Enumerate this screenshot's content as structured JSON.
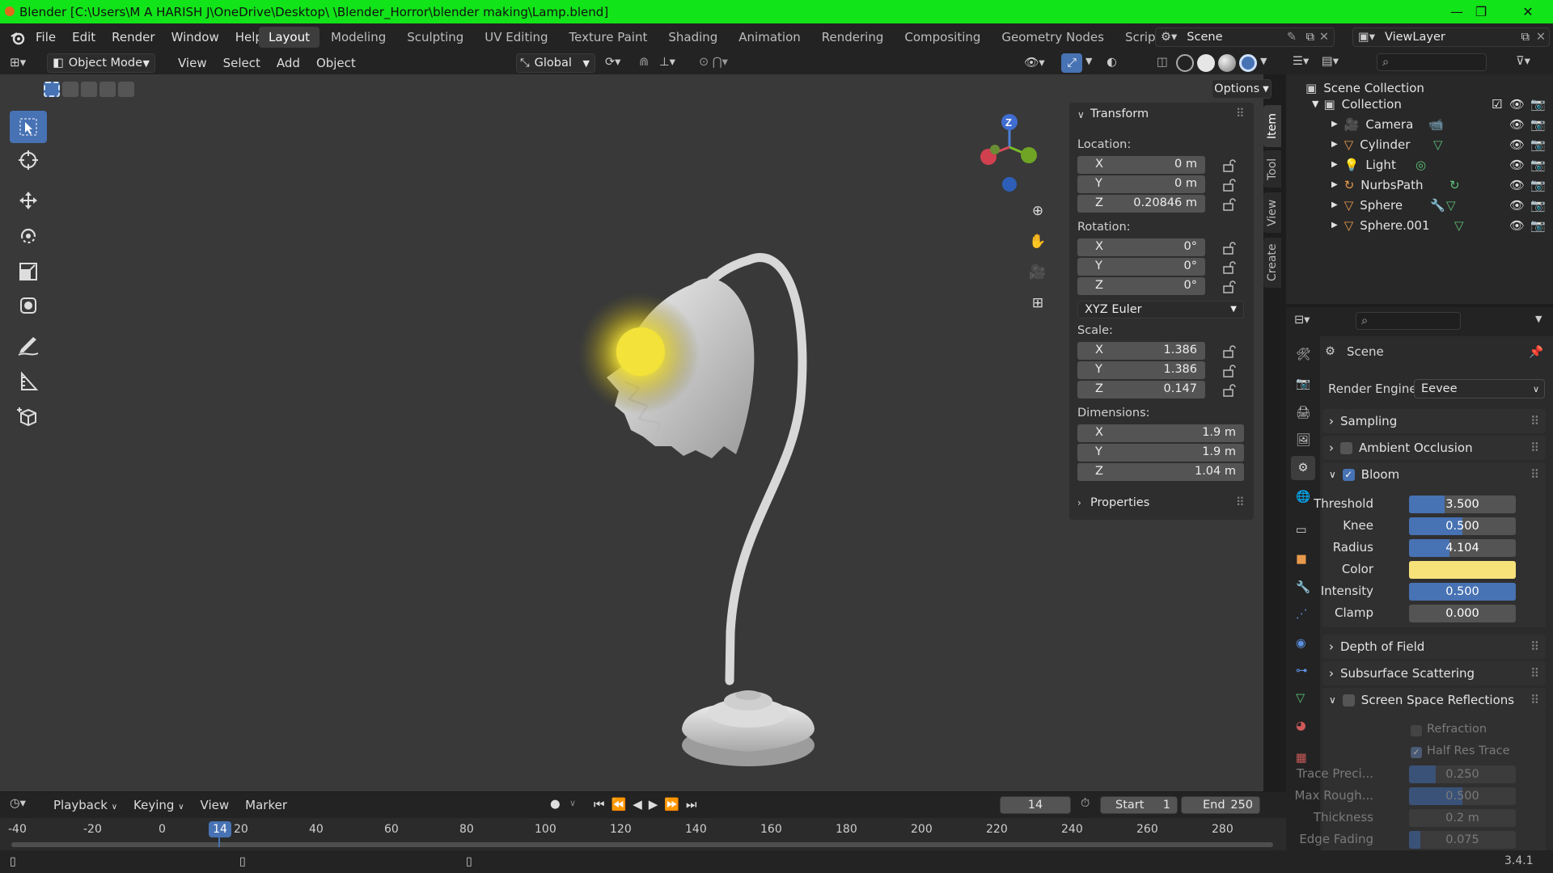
{
  "window": {
    "title": "Blender [C:\\Users\\M A HARISH J\\OneDrive\\Desktop\\ \\Blender_Horror\\blender making\\Lamp.blend]",
    "minimize": "—",
    "maximize": "❐",
    "close": "✕"
  },
  "menu": [
    "File",
    "Edit",
    "Render",
    "Window",
    "Help"
  ],
  "workspaces": [
    "Layout",
    "Modeling",
    "Sculpting",
    "UV Editing",
    "Texture Paint",
    "Shading",
    "Animation",
    "Rendering",
    "Compositing",
    "Geometry Nodes",
    "Scripting"
  ],
  "add_workspace": "+",
  "scene_name": "Scene",
  "viewlayer_name": "ViewLayer",
  "header": {
    "mode": "Object Mode",
    "menus": [
      "View",
      "Select",
      "Add",
      "Object"
    ],
    "orientation": "Global",
    "options": "Options"
  },
  "gizmo": {
    "z": "Z"
  },
  "npanel": {
    "transform_title": "Transform",
    "location_label": "Location:",
    "location": [
      {
        "axis": "X",
        "value": "0 m"
      },
      {
        "axis": "Y",
        "value": "0 m"
      },
      {
        "axis": "Z",
        "value": "0.20846 m"
      }
    ],
    "rotation_label": "Rotation:",
    "rotation": [
      {
        "axis": "X",
        "value": "0°"
      },
      {
        "axis": "Y",
        "value": "0°"
      },
      {
        "axis": "Z",
        "value": "0°"
      }
    ],
    "rotation_mode": "XYZ Euler",
    "scale_label": "Scale:",
    "scale": [
      {
        "axis": "X",
        "value": "1.386"
      },
      {
        "axis": "Y",
        "value": "1.386"
      },
      {
        "axis": "Z",
        "value": "0.147"
      }
    ],
    "dimensions_label": "Dimensions:",
    "dimensions": [
      {
        "axis": "X",
        "value": "1.9 m"
      },
      {
        "axis": "Y",
        "value": "1.9 m"
      },
      {
        "axis": "Z",
        "value": "1.04 m"
      }
    ],
    "properties_title": "Properties",
    "tabs": [
      "Item",
      "Tool",
      "View",
      "Create"
    ]
  },
  "outliner": {
    "root": "Scene Collection",
    "collection": "Collection",
    "items": [
      "Camera",
      "Cylinder",
      "Light",
      "NurbsPath",
      "Sphere",
      "Sphere.001"
    ]
  },
  "properties": {
    "context": "Scene",
    "render_engine_label": "Render Engine",
    "render_engine": "Eevee",
    "sampling": "Sampling",
    "ambient_occlusion": "Ambient Occlusion",
    "bloom": "Bloom",
    "bloom_fields": {
      "threshold_label": "Threshold",
      "threshold": "3.500",
      "knee_label": "Knee",
      "knee": "0.500",
      "radius_label": "Radius",
      "radius": "4.104",
      "color_label": "Color",
      "intensity_label": "Intensity",
      "intensity": "0.500",
      "clamp_label": "Clamp",
      "clamp": "0.000"
    },
    "bloom_color": "#f7e27a",
    "depth_of_field": "Depth of Field",
    "subsurface_scattering": "Subsurface Scattering",
    "screen_space_reflections": "Screen Space Reflections",
    "ssr": {
      "refraction": "Refraction",
      "half_res_trace": "Half Res Trace",
      "trace_precision_label": "Trace Preci...",
      "trace_precision": "0.250",
      "max_roughness_label": "Max Rough...",
      "max_roughness": "0.500",
      "thickness_label": "Thickness",
      "thickness": "0.2 m",
      "edge_fading_label": "Edge Fading",
      "edge_fading": "0.075"
    }
  },
  "timeline": {
    "menus": [
      "Playback",
      "Keying",
      "View",
      "Marker"
    ],
    "current_frame": "14",
    "start_label": "Start",
    "start": "1",
    "end_label": "End",
    "end": "250",
    "ticks": [
      "-40",
      "-20",
      "0",
      "20",
      "40",
      "60",
      "80",
      "100",
      "120",
      "140",
      "160",
      "180",
      "200",
      "220",
      "240",
      "260",
      "280"
    ]
  },
  "version": "3.4.1",
  "colors": {
    "accent": "#4772b3",
    "titlebar": "#12e41a",
    "bulb": "#f2e23a"
  }
}
